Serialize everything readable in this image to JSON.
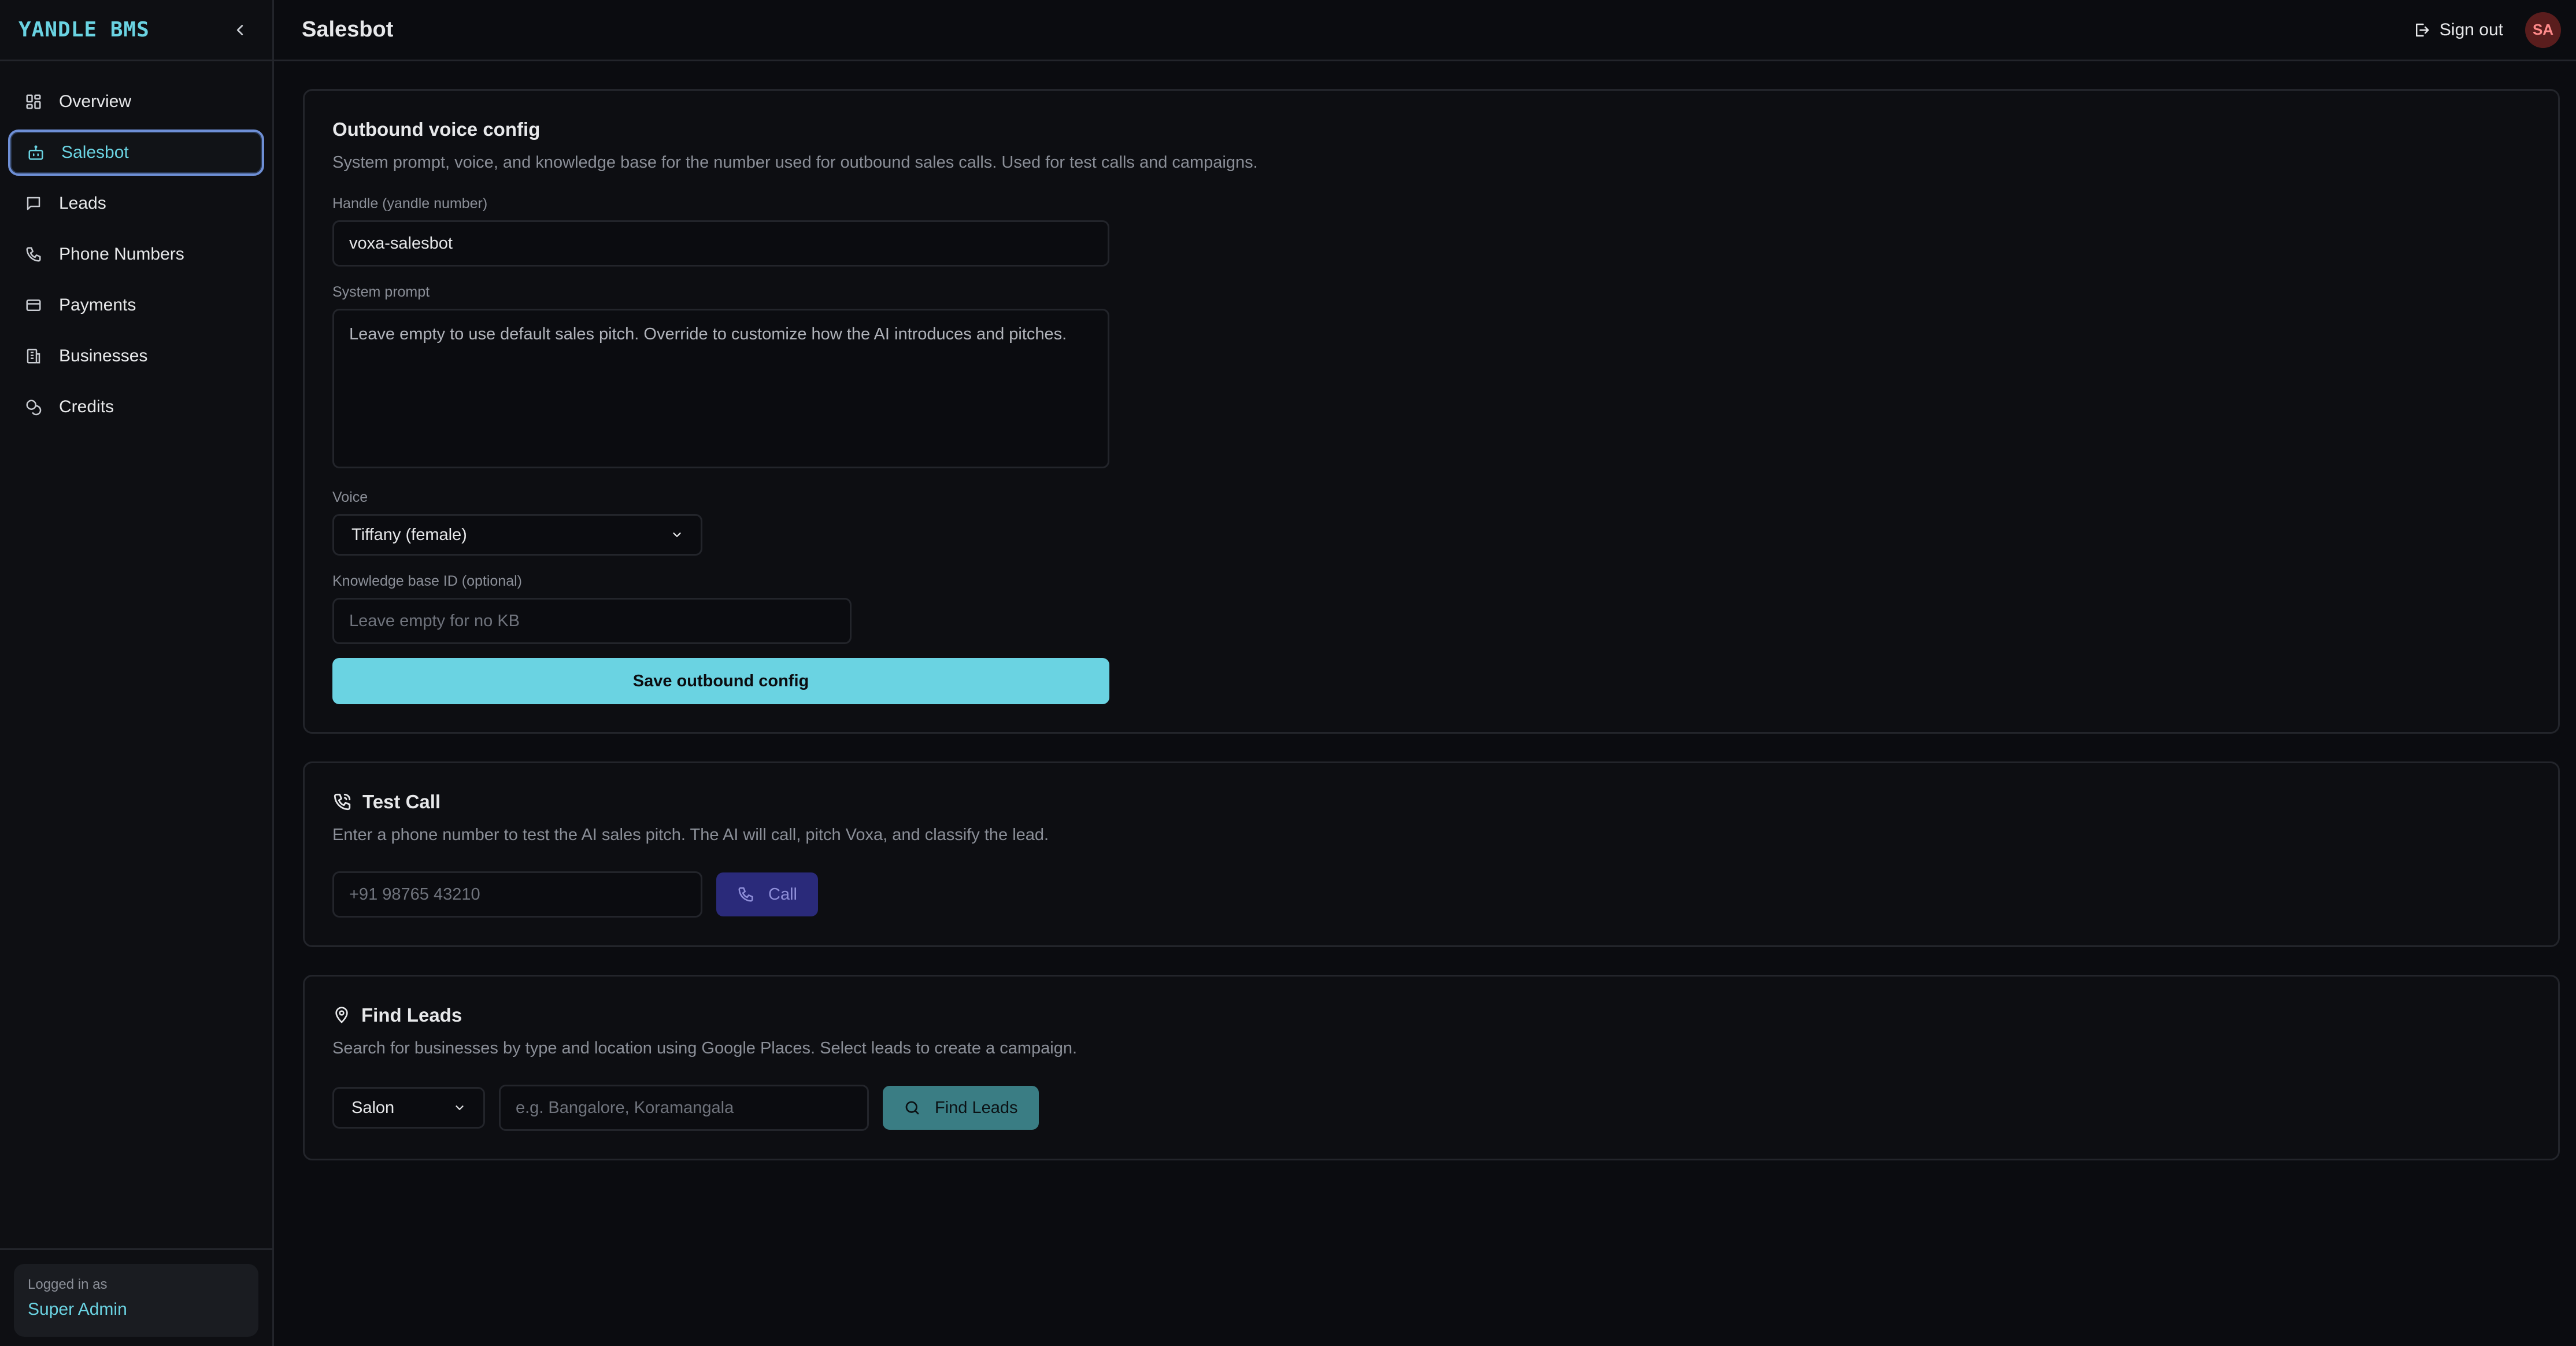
{
  "brand": "YANDLE BMS",
  "sidebar": {
    "items": [
      {
        "label": "Overview",
        "icon": "grid-icon"
      },
      {
        "label": "Salesbot",
        "icon": "bot-icon",
        "active": true
      },
      {
        "label": "Leads",
        "icon": "chat-icon"
      },
      {
        "label": "Phone Numbers",
        "icon": "phone-icon"
      },
      {
        "label": "Payments",
        "icon": "card-icon"
      },
      {
        "label": "Businesses",
        "icon": "building-icon"
      },
      {
        "label": "Credits",
        "icon": "coins-icon"
      }
    ],
    "logged_in_caption": "Logged in as",
    "user_name": "Super Admin"
  },
  "header": {
    "title": "Salesbot",
    "signout_label": "Sign out",
    "avatar_initials": "SA"
  },
  "outbound": {
    "title": "Outbound voice config",
    "desc": "System prompt, voice, and knowledge base for the number used for outbound sales calls. Used for test calls and campaigns.",
    "handle_label": "Handle (yandle number)",
    "handle_value": "voxa-salesbot",
    "prompt_label": "System prompt",
    "prompt_placeholder": "Leave empty to use default sales pitch. Override to customize how the AI introduces and pitches.",
    "voice_label": "Voice",
    "voice_value": "Tiffany (female)",
    "kb_label": "Knowledge base ID (optional)",
    "kb_placeholder": "Leave empty for no KB",
    "save_label": "Save outbound config"
  },
  "test_call": {
    "title": "Test Call",
    "desc": "Enter a phone number to test the AI sales pitch. The AI will call, pitch Voxa, and classify the lead.",
    "phone_placeholder": "+91 98765 43210",
    "call_label": "Call"
  },
  "find_leads": {
    "title": "Find Leads",
    "desc": "Search for businesses by type and location using Google Places. Select leads to create a campaign.",
    "type_value": "Salon",
    "location_placeholder": "e.g. Bangalore, Koramangala",
    "find_label": "Find Leads"
  },
  "colors": {
    "accent": "#6ad3e2",
    "call_button": "#2a2a7a",
    "find_button": "#3a7d84",
    "avatar_bg": "#5a1d1d"
  }
}
